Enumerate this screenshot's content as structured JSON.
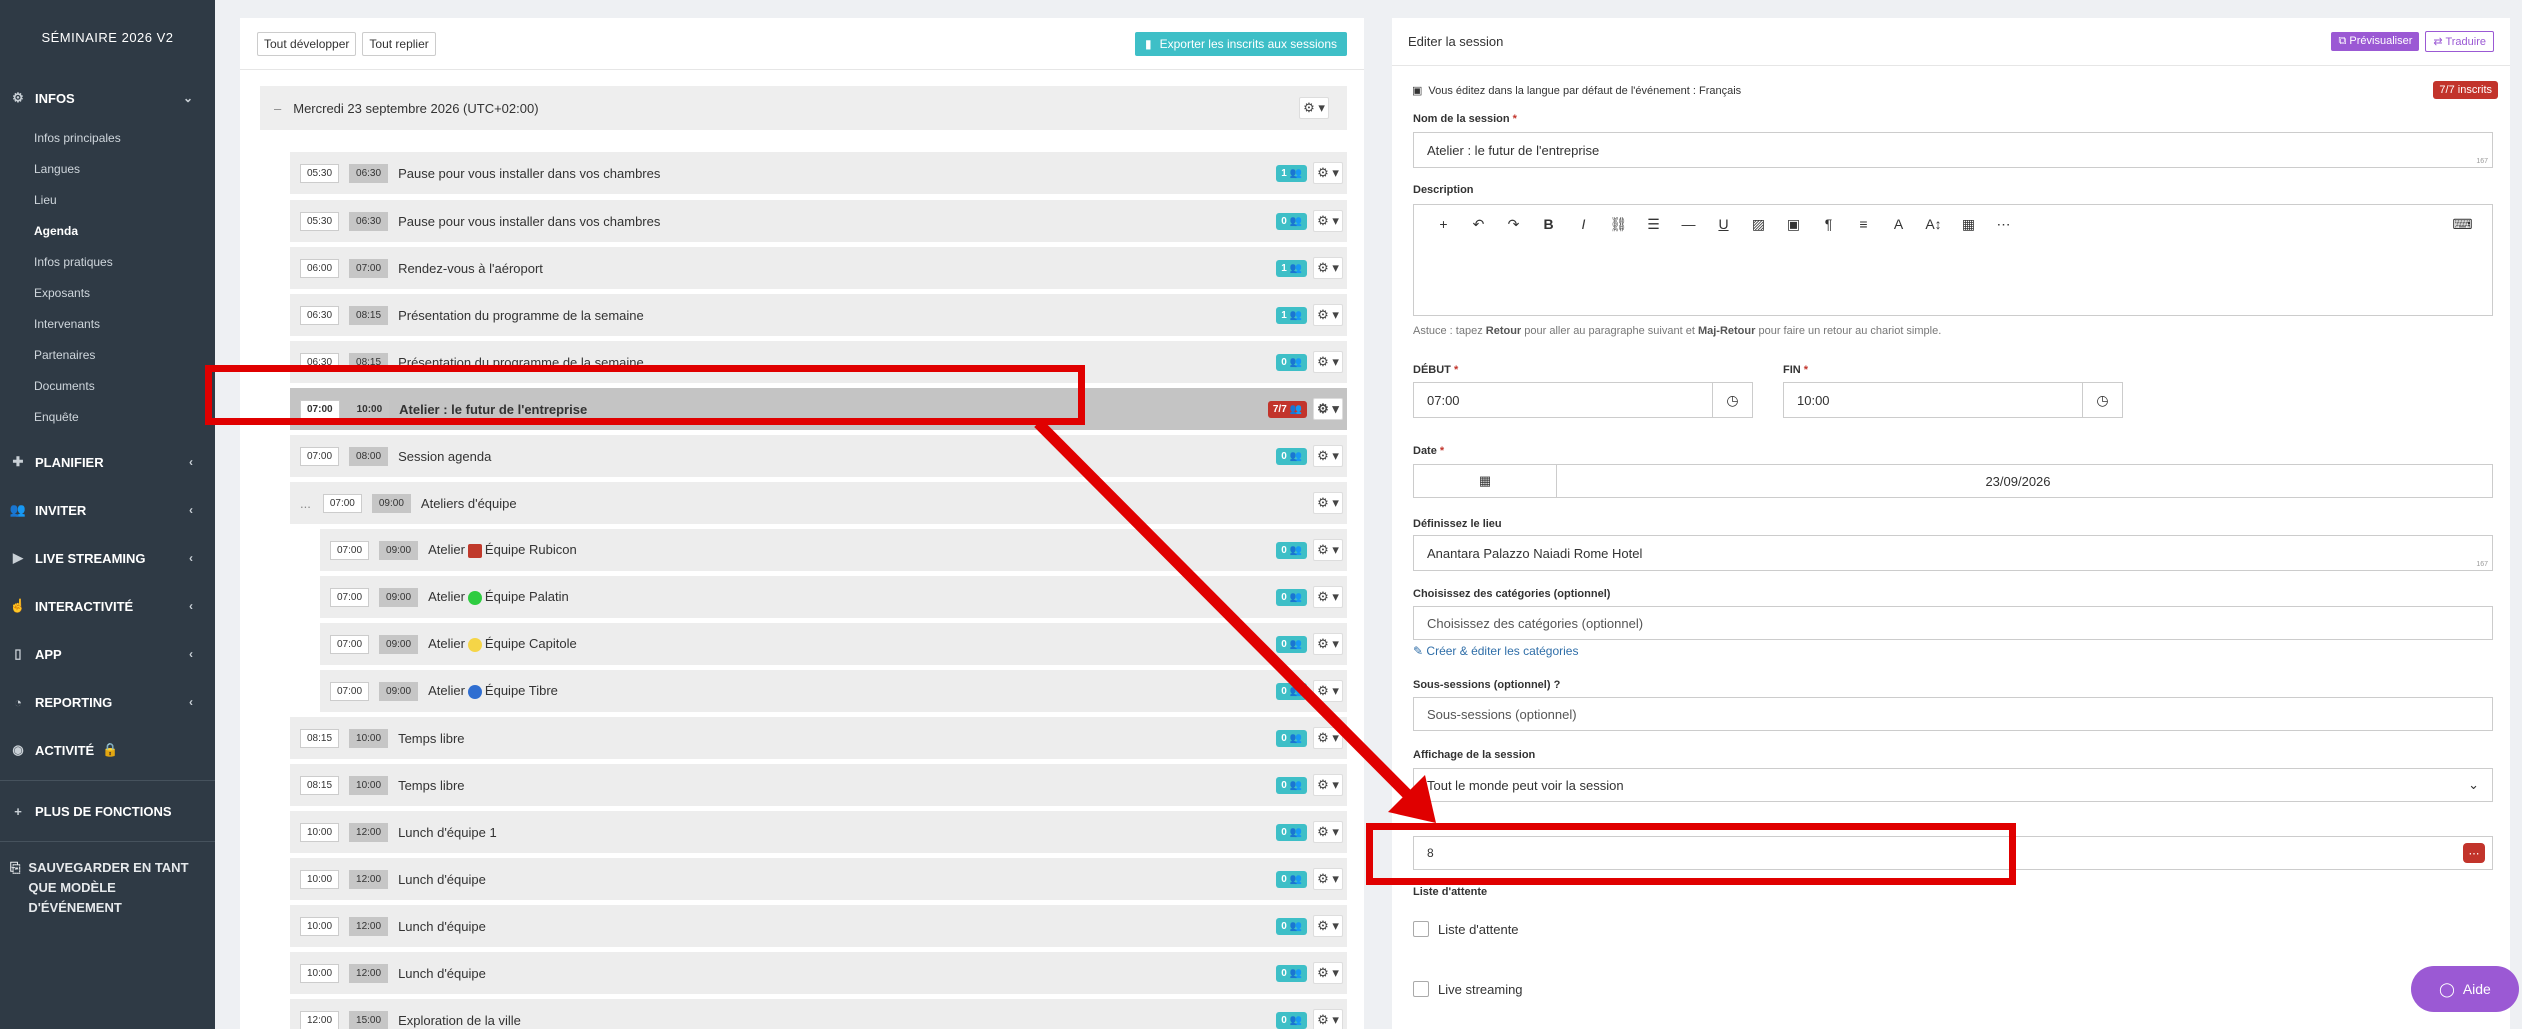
{
  "sidebar": {
    "title": "SÉMINAIRE 2026 V2",
    "infos_label": "INFOS",
    "infos_items": [
      "Infos principales",
      "Langues",
      "Lieu",
      "Agenda",
      "Infos pratiques",
      "Exposants",
      "Intervenants",
      "Partenaires",
      "Documents",
      "Enquête"
    ],
    "sections": [
      "PLANIFIER",
      "INVITER",
      "LIVE STREAMING",
      "INTERACTIVITÉ",
      "APP",
      "REPORTING",
      "ACTIVITÉ"
    ],
    "more": "PLUS DE FONCTIONS",
    "save": "SAUVEGARDER EN TANT QUE MODÈLE D'ÉVÉNEMENT"
  },
  "agenda": {
    "expand_all": "Tout développer",
    "collapse_all": "Tout replier",
    "export": "Exporter les inscrits aux sessions",
    "day": "Mercredi 23 septembre 2026 (UTC+02:00)",
    "sessions": [
      {
        "start": "05:30",
        "end": "06:30",
        "title": "Pause pour vous installer dans vos chambres",
        "badge": "1"
      },
      {
        "start": "05:30",
        "end": "06:30",
        "title": "Pause pour vous installer dans vos chambres",
        "badge": "0"
      },
      {
        "start": "06:00",
        "end": "07:00",
        "title": "Rendez-vous à l'aéroport",
        "badge": "1"
      },
      {
        "start": "06:30",
        "end": "08:15",
        "title": "Présentation du programme de la semaine",
        "badge": "1"
      },
      {
        "start": "06:30",
        "end": "08:15",
        "title": "Présentation du programme de la semaine",
        "badge": "0"
      },
      {
        "start": "07:00",
        "end": "10:00",
        "title": "Atelier : le futur de l'entreprise",
        "badge": "7/7"
      },
      {
        "start": "07:00",
        "end": "08:00",
        "title": "Session agenda",
        "badge": "0"
      },
      {
        "start": "07:00",
        "end": "09:00",
        "title": "Ateliers d'équipe",
        "badge": "",
        "collapse": "..."
      },
      {
        "start": "07:00",
        "end": "09:00",
        "title_pre": "Atelier",
        "title_post": "Équipe Rubicon",
        "badge": "0"
      },
      {
        "start": "07:00",
        "end": "09:00",
        "title_pre": "Atelier",
        "title_post": "Équipe Palatin",
        "badge": "0"
      },
      {
        "start": "07:00",
        "end": "09:00",
        "title_pre": "Atelier",
        "title_post": "Équipe Capitole",
        "badge": "0"
      },
      {
        "start": "07:00",
        "end": "09:00",
        "title_pre": "Atelier",
        "title_post": "Équipe Tibre",
        "badge": "0"
      },
      {
        "start": "08:15",
        "end": "10:00",
        "title": "Temps libre",
        "badge": "0"
      },
      {
        "start": "08:15",
        "end": "10:00",
        "title": "Temps libre",
        "badge": "0"
      },
      {
        "start": "10:00",
        "end": "12:00",
        "title": "Lunch d'équipe 1",
        "badge": "0"
      },
      {
        "start": "10:00",
        "end": "12:00",
        "title": "Lunch d'équipe",
        "badge": "0"
      },
      {
        "start": "10:00",
        "end": "12:00",
        "title": "Lunch d'équipe",
        "badge": "0"
      },
      {
        "start": "10:00",
        "end": "12:00",
        "title": "Lunch d'équipe",
        "badge": "0"
      },
      {
        "start": "12:00",
        "end": "15:00",
        "title": "Exploration de la ville",
        "badge": "0"
      }
    ]
  },
  "editor": {
    "title": "Editer la session",
    "preview": "Prévisualiser",
    "translate": "Traduire",
    "lang_note": "Vous éditez dans la langue par défaut de l'événement : Français",
    "inscrits": "7/7 inscrits",
    "name_label": "Nom de la session",
    "name_value": "Atelier : le futur de l'entreprise",
    "counter": "167",
    "description_label": "Description",
    "hint_pre": "Astuce : tapez ",
    "hint_k1": "Retour",
    "hint_mid": " pour aller au paragraphe suivant et ",
    "hint_k2": "Maj-Retour",
    "hint_post": " pour faire un retour au chariot simple.",
    "start_label": "DÉBUT",
    "start_value": "07:00",
    "end_label": "FIN",
    "end_value": "10:00",
    "date_label": "Date",
    "date_value": "23/09/2026",
    "place_label": "Définissez le lieu",
    "place_value": "Anantara Palazzo Naiadi Rome Hotel",
    "place_counter": "167",
    "categories_label": "Choisissez des catégories (optionnel)",
    "categories_placeholder": "Choisissez des catégories (optionnel)",
    "categories_link": "Créer & éditer les catégories",
    "subsessions_label": "Sous-sessions (optionnel)",
    "subsessions_placeholder": "Sous-sessions (optionnel)",
    "display_label": "Affichage de la session",
    "display_value": "Tout le monde peut voir la session",
    "capacity_value": "8",
    "waitlist_label": "Liste d'attente",
    "waitlist_checkbox": "Liste d'attente",
    "live_checkbox": "Live streaming"
  },
  "help": "Aide",
  "colors": {
    "accent": "#3ebfc7",
    "danger": "#c2342b",
    "purple": "#9b59d4",
    "sidebar": "#2f3a45",
    "annotation": "#e00000"
  }
}
